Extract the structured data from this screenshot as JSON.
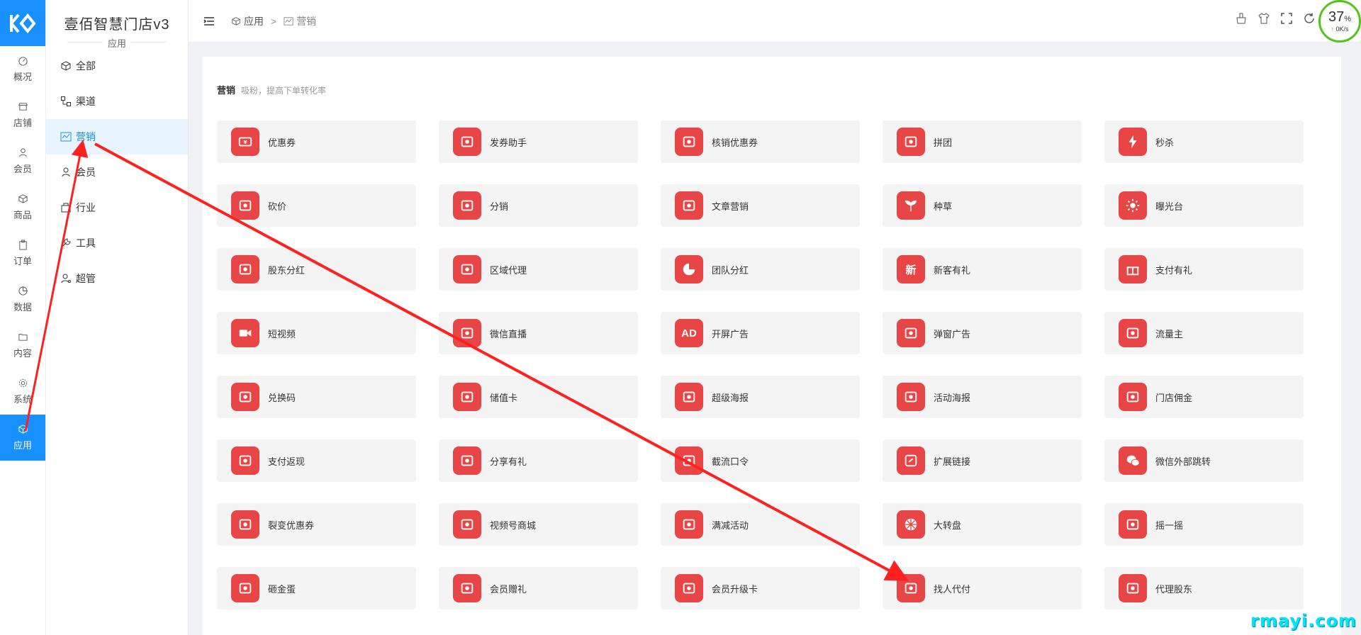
{
  "rail": {
    "items": [
      {
        "label": "概况",
        "icon": "dashboard-icon"
      },
      {
        "label": "店铺",
        "icon": "store-icon"
      },
      {
        "label": "会员",
        "icon": "user-icon"
      },
      {
        "label": "商品",
        "icon": "box-icon"
      },
      {
        "label": "订单",
        "icon": "clipboard-icon"
      },
      {
        "label": "数据",
        "icon": "pie-chart-icon"
      },
      {
        "label": "内容",
        "icon": "folder-icon"
      },
      {
        "label": "系统",
        "icon": "gear-icon"
      },
      {
        "label": "应用",
        "icon": "box-icon",
        "active": true
      }
    ]
  },
  "brand": {
    "title": "壹佰智慧门店v3",
    "subtitle": "应用"
  },
  "submenu": {
    "items": [
      {
        "label": "全部",
        "icon": "cube-icon"
      },
      {
        "label": "渠道",
        "icon": "channel-icon"
      },
      {
        "label": "营销",
        "icon": "chart-icon",
        "active": true
      },
      {
        "label": "会员",
        "icon": "user-icon"
      },
      {
        "label": "行业",
        "icon": "industry-icon"
      },
      {
        "label": "工具",
        "icon": "wrench-icon"
      },
      {
        "label": "超管",
        "icon": "admin-icon"
      }
    ]
  },
  "header": {
    "breadcrumb": [
      "应用",
      "营销"
    ],
    "separator": ">",
    "tools": [
      "clean-icon",
      "shirt-icon",
      "fullscreen-icon",
      "refresh-icon"
    ],
    "speed": {
      "percent": "37",
      "percent_unit": "%",
      "arrow": "↑",
      "rate": "0K/s"
    }
  },
  "section": {
    "title": "营销",
    "desc": "吸粉，提高下单转化率"
  },
  "tiles": [
    {
      "label": "优惠券",
      "icon": "coupon-icon"
    },
    {
      "label": "发券助手",
      "icon": "coupon-send-icon"
    },
    {
      "label": "核销优惠券",
      "icon": "coupon-verify-icon"
    },
    {
      "label": "拼团",
      "icon": "group-buy-icon"
    },
    {
      "label": "秒杀",
      "icon": "flash-icon"
    },
    {
      "label": "砍价",
      "icon": "bargain-icon"
    },
    {
      "label": "分销",
      "icon": "money-bag-icon"
    },
    {
      "label": "文章营销",
      "icon": "article-icon"
    },
    {
      "label": "种草",
      "icon": "sprout-icon"
    },
    {
      "label": "曝光台",
      "icon": "sun-icon"
    },
    {
      "label": "股东分红",
      "icon": "share-icon"
    },
    {
      "label": "区域代理",
      "icon": "coins-icon"
    },
    {
      "label": "团队分红",
      "icon": "pie-icon"
    },
    {
      "label": "新客有礼",
      "icon": "new-customer-icon",
      "glyph": "新"
    },
    {
      "label": "支付有礼",
      "icon": "gift-icon"
    },
    {
      "label": "短视频",
      "icon": "video-camera-icon"
    },
    {
      "label": "微信直播",
      "icon": "live-icon"
    },
    {
      "label": "开屏广告",
      "icon": "ad-screen-icon",
      "glyph": "AD"
    },
    {
      "label": "弹窗广告",
      "icon": "popup-ad-icon"
    },
    {
      "label": "流量主",
      "icon": "traffic-icon"
    },
    {
      "label": "兑换码",
      "icon": "redeem-code-icon"
    },
    {
      "label": "储值卡",
      "icon": "stored-card-icon"
    },
    {
      "label": "超级海报",
      "icon": "star-poster-icon"
    },
    {
      "label": "活动海报",
      "icon": "activity-poster-icon"
    },
    {
      "label": "门店佣金",
      "icon": "commission-icon"
    },
    {
      "label": "支付返现",
      "icon": "cashback-icon"
    },
    {
      "label": "分享有礼",
      "icon": "share-gift-icon"
    },
    {
      "label": "截流口令",
      "icon": "command-icon"
    },
    {
      "label": "扩展链接",
      "icon": "link-icon"
    },
    {
      "label": "微信外部跳转",
      "icon": "wechat-icon"
    },
    {
      "label": "裂变优惠券",
      "icon": "fission-coupon-icon"
    },
    {
      "label": "视频号商城",
      "icon": "video-mall-icon"
    },
    {
      "label": "满减活动",
      "icon": "discount-icon"
    },
    {
      "label": "大转盘",
      "icon": "wheel-icon"
    },
    {
      "label": "摇一摇",
      "icon": "shake-icon"
    },
    {
      "label": "砸金蛋",
      "icon": "golden-egg-icon"
    },
    {
      "label": "会员赠礼",
      "icon": "member-gift-icon"
    },
    {
      "label": "会员升级卡",
      "icon": "member-upgrade-icon"
    },
    {
      "label": "找人代付",
      "icon": "pay-for-me-icon"
    },
    {
      "label": "代理股东",
      "icon": "agent-shareholder-icon"
    }
  ],
  "watermark": "rmayi.com",
  "colors": {
    "accent": "#1890ff",
    "tile_icon": "#e84646",
    "annotation": "#ff2020"
  }
}
